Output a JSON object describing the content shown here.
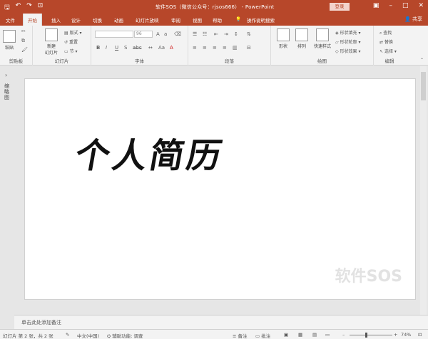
{
  "window": {
    "title": "软件SOS（微信公众号：rjsos666） -  PowerPoint",
    "login_label": "登录"
  },
  "quick_access": [
    "save-icon",
    "undo-icon",
    "redo-icon",
    "start-slideshow-icon"
  ],
  "tabs": [
    "文件",
    "开始",
    "插入",
    "设计",
    "切换",
    "动画",
    "幻灯片放映",
    "审阅",
    "视图",
    "帮助",
    "操作说明搜索"
  ],
  "active_tab": "开始",
  "share_label": "共享",
  "ribbon": {
    "clipboard": {
      "label": "剪贴板",
      "paste": "粘贴"
    },
    "slides": {
      "label": "幻灯片",
      "new_slide": "新建",
      "new_slide2": "幻灯片",
      "layout": "版式",
      "reset": "重置",
      "section": "节"
    },
    "font": {
      "label": "字体",
      "font_name": "",
      "font_size": "96",
      "bold": "B",
      "italic": "I",
      "underline": "U",
      "strike": "S",
      "shadow": "abc"
    },
    "paragraph": {
      "label": "段落"
    },
    "drawing": {
      "label": "绘图",
      "shapes": "形状",
      "arrange": "排列",
      "quick_styles": "快速样式",
      "fill": "形状填充",
      "outline": "形状轮廓",
      "effect": "形状效果"
    },
    "editing": {
      "label": "编辑",
      "find": "查找",
      "replace": "替换",
      "select": "选择"
    }
  },
  "left_pane": {
    "label": "缩略图"
  },
  "slide": {
    "title": "个人简历"
  },
  "watermark": "软件SOS",
  "notes": {
    "placeholder": "单击此处添加备注"
  },
  "status": {
    "slide_info": "幻灯片 第 2 张，共 2 张",
    "language": "中文(中国)",
    "accessibility": "辅助功能: 调查",
    "notes_btn": "备注",
    "comments_btn": "批注",
    "zoom": "74%"
  }
}
